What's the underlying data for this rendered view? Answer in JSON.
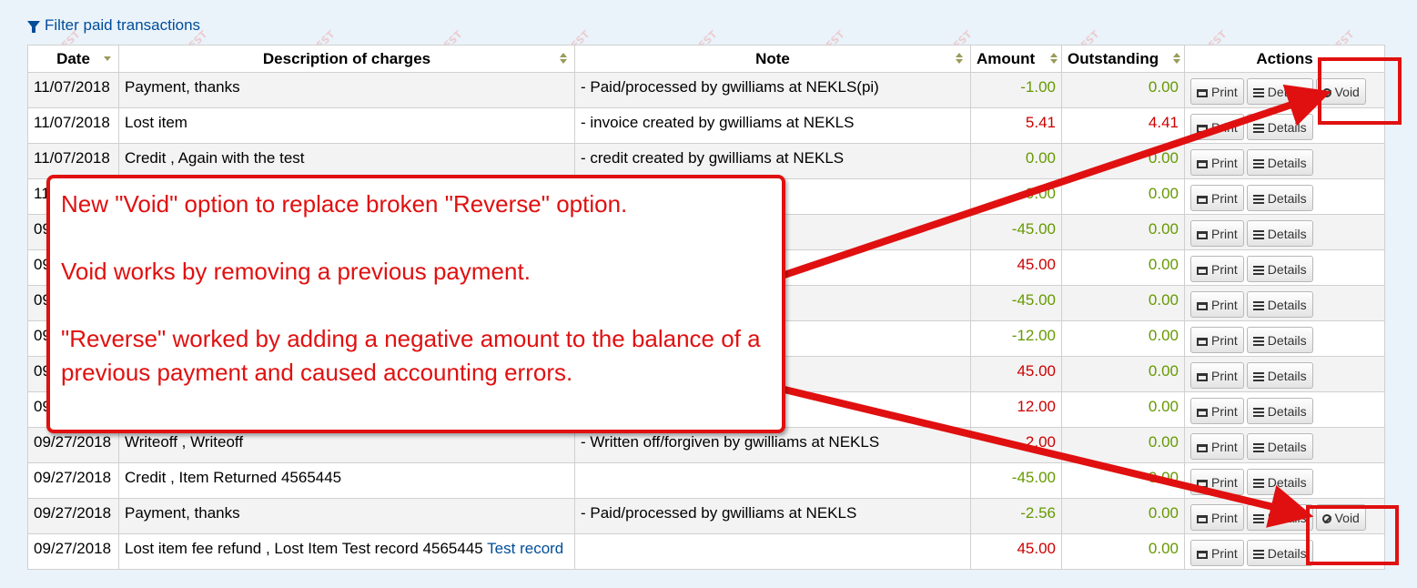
{
  "filter": {
    "label": "Filter paid transactions",
    "icon": "filter-icon"
  },
  "watermark": {
    "text": "TEST"
  },
  "table": {
    "headers": {
      "date": "Date",
      "description": "Description of charges",
      "note": "Note",
      "amount": "Amount",
      "outstanding": "Outstanding",
      "actions": "Actions"
    },
    "buttons": {
      "print": "Print",
      "details": "Details",
      "void": "Void"
    },
    "rows": [
      {
        "date": "11/07/2018",
        "desc": "Payment, thanks",
        "note": "- Paid/processed by gwilliams at NEKLS(pi)",
        "amount": "-1.00",
        "outstanding": "0.00",
        "void": true
      },
      {
        "date": "11/07/2018",
        "desc": "Lost item",
        "note": "- invoice created by gwilliams at NEKLS",
        "amount": "5.41",
        "outstanding": "4.41",
        "void": false
      },
      {
        "date": "11/07/2018",
        "desc": "Credit , Again with the test",
        "note": "- credit created by gwilliams at NEKLS",
        "amount": "0.00",
        "outstanding": "0.00",
        "void": false
      },
      {
        "date": "11/07/2018",
        "desc": "",
        "note": "at NEKLS",
        "amount": "0.00",
        "outstanding": "0.00",
        "void": false
      },
      {
        "date": "09/27/2018",
        "desc": "",
        "note": "",
        "amount": "-45.00",
        "outstanding": "0.00",
        "void": false
      },
      {
        "date": "09/27/2018",
        "desc": "",
        "note": "",
        "amount": "45.00",
        "outstanding": "0.00",
        "void": false
      },
      {
        "date": "09/27/2018",
        "desc": "",
        "note": "iams at NEKLS",
        "amount": "-45.00",
        "outstanding": "0.00",
        "void": false
      },
      {
        "date": "09/27/2018",
        "desc": "",
        "note": "iams at NEKLS",
        "amount": "-12.00",
        "outstanding": "0.00",
        "void": false
      },
      {
        "date": "09/27/2018",
        "desc": "",
        "note": "at NEKLS",
        "amount": "45.00",
        "outstanding": "0.00",
        "void": false
      },
      {
        "date": "09/27/2018",
        "desc": "",
        "note": "ms at NEKLS",
        "amount": "12.00",
        "outstanding": "0.00",
        "void": false
      },
      {
        "date": "09/27/2018",
        "desc": "Writeoff , Writeoff",
        "note": "- Written off/forgiven by gwilliams at NEKLS",
        "amount": "2.00",
        "outstanding": "0.00",
        "void": false
      },
      {
        "date": "09/27/2018",
        "desc": "Credit , Item Returned 4565445",
        "note": "",
        "amount": "-45.00",
        "outstanding": "0.00",
        "void": false
      },
      {
        "date": "09/27/2018",
        "desc": "Payment, thanks",
        "note": "- Paid/processed by gwilliams at NEKLS",
        "amount": "-2.56",
        "outstanding": "0.00",
        "void": true
      },
      {
        "date": "09/27/2018",
        "desc": "Lost item fee refund , Lost Item Test record 4565445",
        "desc_link": "Test record",
        "note": "",
        "amount": "45.00",
        "outstanding": "0.00",
        "void": false
      }
    ]
  },
  "callout": {
    "line1": "New \"Void\" option to replace broken \"Reverse\" option.",
    "line2": "Void works by removing a previous payment.",
    "line3": "\"Reverse\" worked by adding a negative amount to the balance of a previous payment and caused accounting errors."
  },
  "colors": {
    "accent": "#e01010",
    "link": "#004d99",
    "credit": "#669900",
    "debit": "#cc0000"
  }
}
